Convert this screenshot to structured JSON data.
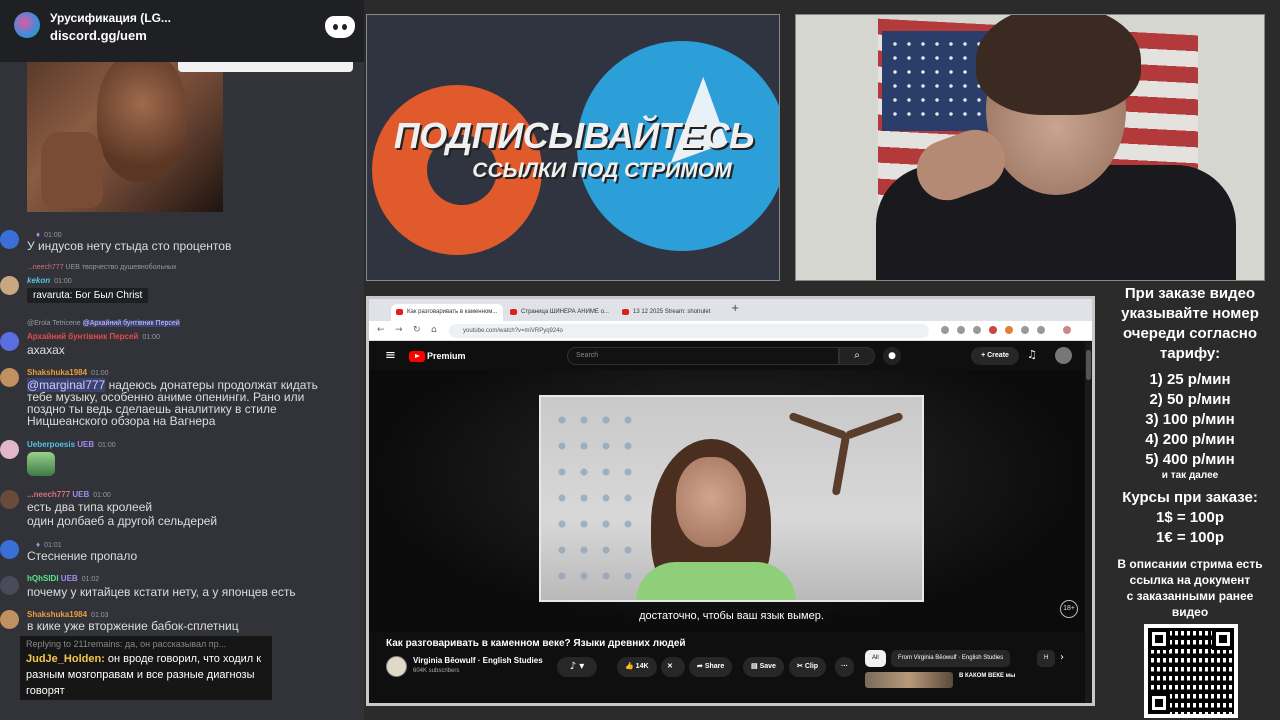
{
  "discord": {
    "server_name": "Урусификация (LG...",
    "invite": "discord.gg/uem",
    "messages": [
      {
        "time": "01:00",
        "text": "У индусов нету стыда сто процентов"
      },
      {
        "reply_user": "...neech777",
        "reply_badge": "UEB",
        "reply_text": "творчество душевнобольных",
        "user": "kekon",
        "time": "01:00",
        "quote": "ravaruta: Бог Был Christ"
      },
      {
        "reply_user": "@Erola Tetricene",
        "reply_mention": "@Архайний бунтівник Персей",
        "user": "Архайний бунтівник Персей",
        "time": "01:00",
        "text": "ахахах"
      },
      {
        "user": "Shakshuka1984",
        "time": "01:00",
        "mention": "@marginal777",
        "lines": [
          "надеюсь донатеры продолжат кидать",
          "тебе музыку, особенно аниме опенинги. Рано или",
          "поздно ты ведь сделаешь аналитику в стиле",
          "Ницшеанского обзора на Вагнера"
        ]
      },
      {
        "user": "Ueberpoesis",
        "badge": "UEB",
        "time": "01:00"
      },
      {
        "user": "...neech777",
        "badge": "UEB",
        "time": "01:00",
        "lines": [
          "есть два типа кролеей",
          "один долбаеб а другой сельдерей"
        ]
      },
      {
        "time": "01:01",
        "text": "Стеснение пропало"
      },
      {
        "user": "hQhSIDI",
        "badge": "UEB",
        "time": "01:02",
        "text": "почему у китайцев кстати нету, а у японцев есть"
      },
      {
        "user": "Shakshuka1984",
        "time": "01:03",
        "text": "в кике уже вторжение бабок-сплетниц"
      }
    ],
    "tts": {
      "reply": "Replying to 211remains: да, он рассказывал пр...",
      "user": "JudJe_Holden:",
      "text": "он вроде говорил, что ходил к разным мозгоправам и все разные диагнозы говорят"
    }
  },
  "promo": {
    "title": "ПОДПИСЫВАЙТЕСЬ",
    "subtitle": "ССЫЛКИ ПОД СТРИМОМ"
  },
  "browser": {
    "tabs": [
      "Как разговаривать в каменном...",
      "Страница ШИНЕРА АНИМЕ о...",
      "13 12 2025 Stream: shotrulet"
    ],
    "new_tab": "+",
    "url": "youtube.com/watch?v=miVRPyq924o"
  },
  "youtube": {
    "brand": "Premium",
    "search_placeholder": "Search",
    "create_label": "Create",
    "subtitle": "достаточно, чтобы ваш язык вымер.",
    "age_badge": "18+",
    "video_title": "Как разговаривать в каменном веке? Языки древних людей",
    "channel": "Virginia Bēowulf · English Studies",
    "subscribers": "604K subscribers",
    "likes": "14K",
    "share": "Share",
    "save": "Save",
    "clip": "Clip",
    "chips": [
      "All",
      "From Virginia Bēowulf · English Studies",
      "H"
    ],
    "rec_title": "В КАКОМ ВЕКЕ мы"
  },
  "prices": {
    "header": [
      "При заказе видео",
      "указывайте номер",
      "очереди согласно",
      "тарифу:"
    ],
    "tiers": [
      "1) 25 р/мин",
      "2) 50 р/мин",
      "3) 100 р/мин",
      "4) 200 р/мин",
      "5) 400 р/мин"
    ],
    "more": "и так далее",
    "rates_header": "Курсы при заказе:",
    "rates": [
      "1$ = 100р",
      "1€ = 100р"
    ],
    "desc": [
      "В описании стрима есть",
      "ссылка на документ",
      "с заказанными ранее",
      "видео"
    ]
  },
  "colors": {
    "discord_bg": "#313338",
    "youtube_red": "#ff0000",
    "telegram_blue": "#2c9ed8",
    "promo_orange": "#e05a2c",
    "tts_name": "#f5c84b"
  }
}
